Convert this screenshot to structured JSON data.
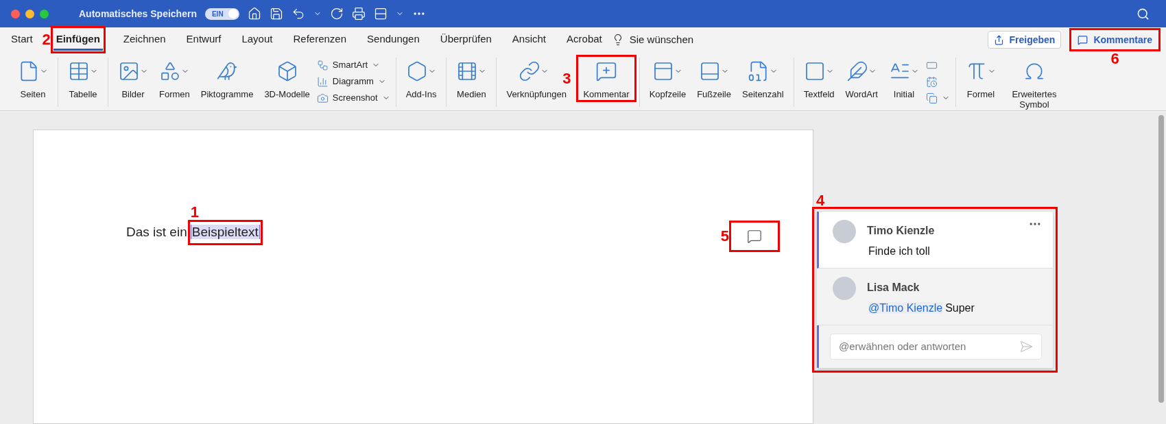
{
  "titlebar": {
    "title": "Automatisches Speichern",
    "autosave": {
      "label": "EIN",
      "on": true
    }
  },
  "tabs": [
    {
      "label": "Start",
      "selected": false
    },
    {
      "label": "Einfügen",
      "selected": true,
      "callout": "2"
    },
    {
      "label": "Zeichnen",
      "selected": false
    },
    {
      "label": "Entwurf",
      "selected": false
    },
    {
      "label": "Layout",
      "selected": false
    },
    {
      "label": "Referenzen",
      "selected": false
    },
    {
      "label": "Sendungen",
      "selected": false
    },
    {
      "label": "Überprüfen",
      "selected": false
    },
    {
      "label": "Ansicht",
      "selected": false
    },
    {
      "label": "Acrobat",
      "selected": false
    }
  ],
  "tell_me": "Sie wünschen",
  "share_button": "Freigeben",
  "comments_button": {
    "label": "Kommentare",
    "callout": "6"
  },
  "ribbon_groups": [
    {
      "items": [
        {
          "kind": "large",
          "label": "Seiten",
          "dropdown": true
        }
      ]
    },
    {
      "items": [
        {
          "kind": "large",
          "label": "Tabelle",
          "dropdown": true
        }
      ]
    },
    {
      "items": [
        {
          "kind": "large",
          "label": "Bilder",
          "dropdown": true
        },
        {
          "kind": "large",
          "label": "Formen",
          "dropdown": true
        },
        {
          "kind": "large",
          "label": "Piktogramme",
          "dropdown": false
        },
        {
          "kind": "large",
          "label": "3D-Modelle",
          "dropdown": false
        },
        {
          "kind": "stack",
          "items": [
            {
              "label": "SmartArt",
              "dropdown": true
            },
            {
              "label": "Diagramm",
              "dropdown": true
            },
            {
              "label": "Screenshot",
              "dropdown": true
            }
          ]
        }
      ]
    },
    {
      "items": [
        {
          "kind": "large",
          "label": "Add-Ins",
          "dropdown": true
        }
      ]
    },
    {
      "items": [
        {
          "kind": "large",
          "label": "Medien",
          "dropdown": true
        }
      ]
    },
    {
      "items": [
        {
          "kind": "large",
          "label": "Verknüpfungen",
          "dropdown": true
        },
        {
          "kind": "large",
          "label": "Kommentar",
          "dropdown": false,
          "callout": "3"
        }
      ]
    },
    {
      "items": [
        {
          "kind": "large",
          "label": "Kopfzeile",
          "dropdown": true
        },
        {
          "kind": "large",
          "label": "Fußzeile",
          "dropdown": true
        },
        {
          "kind": "large",
          "label": "Seitenzahl",
          "dropdown": true
        }
      ]
    },
    {
      "items": [
        {
          "kind": "large",
          "label": "Textfeld",
          "dropdown": true
        },
        {
          "kind": "large",
          "label": "WordArt",
          "dropdown": true
        },
        {
          "kind": "large",
          "label": "Initial",
          "dropdown": true
        },
        {
          "kind": "stack",
          "items": [
            {
              "dropdown": false
            },
            {
              "dropdown": false
            },
            {
              "dropdown": true
            }
          ]
        }
      ]
    },
    {
      "items": [
        {
          "kind": "large",
          "label": "Formel",
          "dropdown": true
        },
        {
          "kind": "large",
          "label": "Erweitertes Symbol",
          "dropdown": false
        }
      ]
    }
  ],
  "document": {
    "text": "Das ist ein",
    "selection": {
      "text": "Beispieltext",
      "callout": "1"
    },
    "comment_marker": {
      "callout": "5"
    }
  },
  "comment_panel": {
    "callout": "4",
    "comments": [
      {
        "author": "Timo Kienzle",
        "text": "Finde ich toll"
      },
      {
        "author": "Lisa Mack",
        "mention": "@Timo Kienzle",
        "text": "Super"
      }
    ],
    "reply_placeholder": "@erwähnen oder antworten"
  }
}
